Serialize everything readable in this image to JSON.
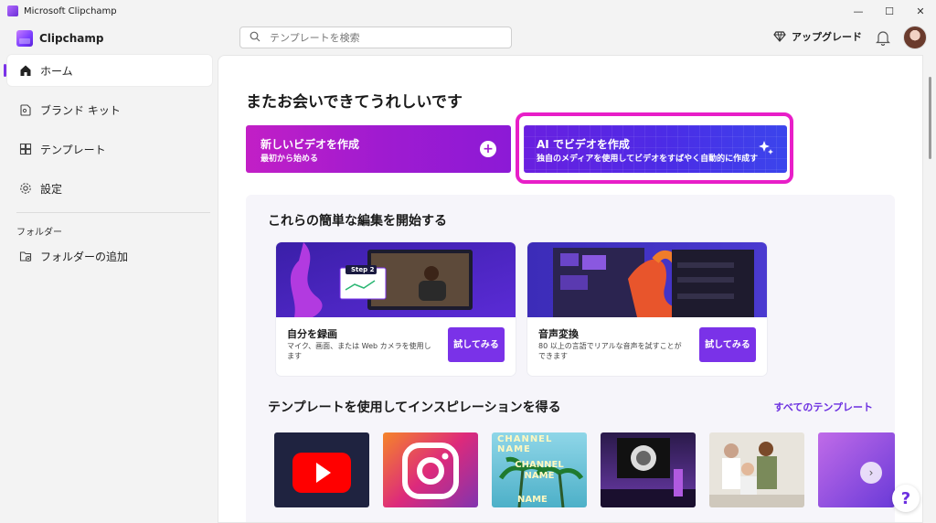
{
  "window": {
    "title": "Microsoft Clipchamp",
    "minimize": "—",
    "maximize": "☐",
    "close": "✕"
  },
  "header": {
    "brand": "Clipchamp",
    "search_placeholder": "テンプレートを検索",
    "upgrade_label": "アップグレード"
  },
  "sidebar": {
    "items": [
      {
        "label": "ホーム",
        "icon": "home-icon",
        "active": true
      },
      {
        "label": "ブランド キット",
        "icon": "brand-kit-icon",
        "active": false
      },
      {
        "label": "テンプレート",
        "icon": "templates-icon",
        "active": false
      },
      {
        "label": "設定",
        "icon": "gear-icon",
        "active": false
      }
    ],
    "folder_heading": "フォルダー",
    "add_folder": "フォルダーの追加"
  },
  "main": {
    "welcome": "またお会いできてうれしいです",
    "new_video": {
      "title": "新しいビデオを作成",
      "subtitle": "最初から始める"
    },
    "ai_video": {
      "title": "AI でビデオを作成",
      "subtitle": "独自のメディアを使用してビデオをすばやく自動的に作成す"
    },
    "quick_start": {
      "title": "これらの簡単な編集を開始する",
      "cards": [
        {
          "title": "自分を録画",
          "desc": "マイク、画面、または Web カメラを使用します",
          "button": "試してみる",
          "thumb_text": "Step 2"
        },
        {
          "title": "音声変換",
          "desc": "80 以上の言語でリアルな音声を試すことができます",
          "button": "試してみる"
        }
      ]
    },
    "inspiration": {
      "title": "テンプレートを使用してインスピレーションを得る",
      "all_link": "すべてのテンプレート",
      "template_thumbs": [
        "youtube",
        "instagram",
        "channel-name",
        "gaming-setup",
        "people",
        "gradient"
      ],
      "template_thumb_text": [
        "CHANNEL NAME",
        "CHANNEL NAME",
        "NAME"
      ]
    }
  },
  "help_label": "?",
  "colors": {
    "accent": "#7a32e8",
    "highlight": "#e81ec8",
    "new_video": "#b01cd0",
    "ai_video": "#4b2ce6"
  }
}
